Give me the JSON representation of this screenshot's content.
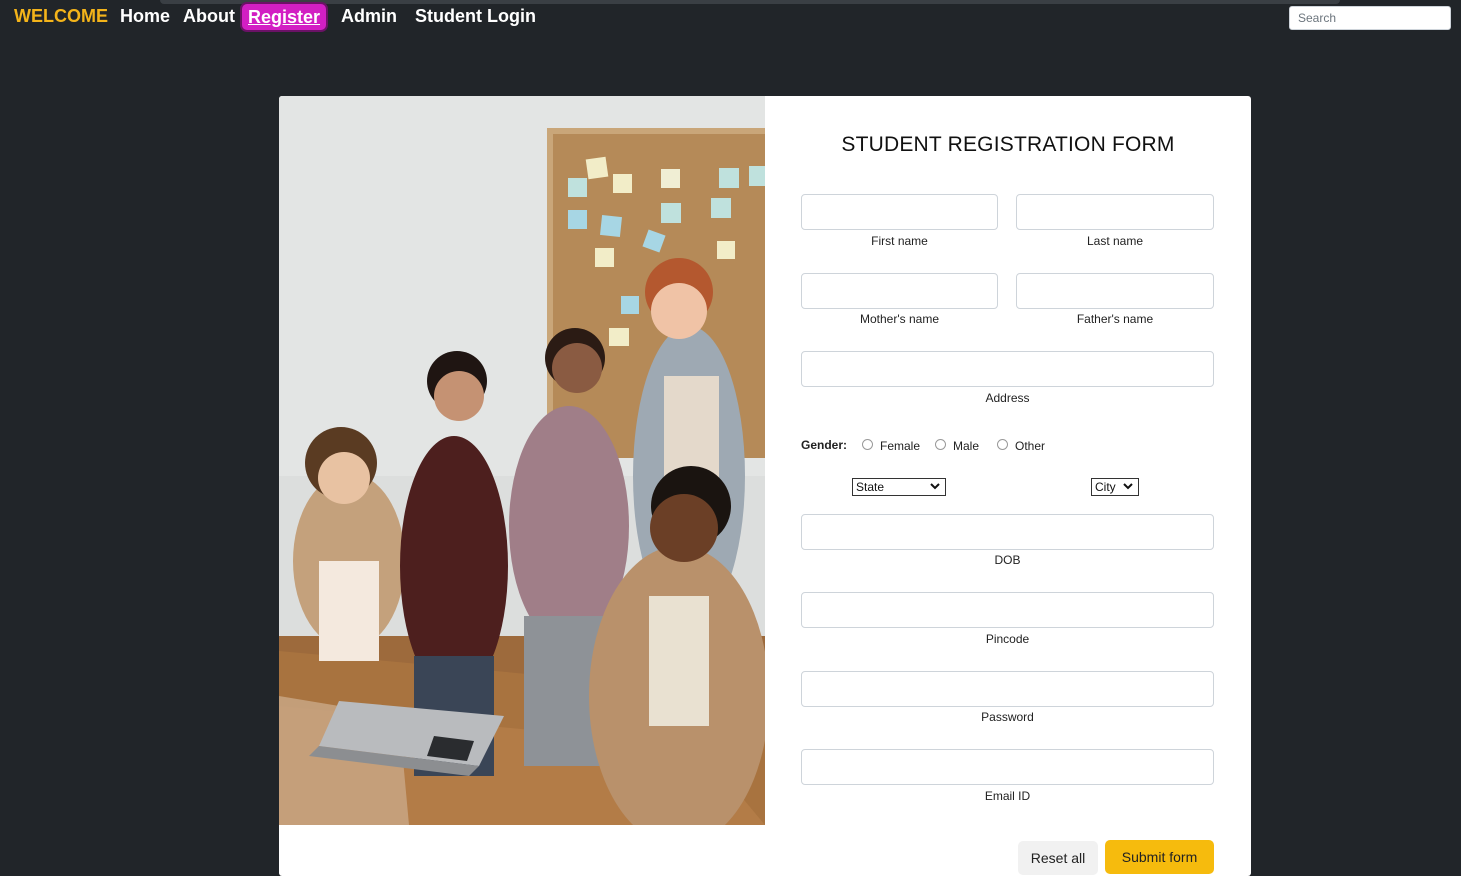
{
  "nav": {
    "brand": "WELCOME",
    "links": [
      "Home",
      "About",
      "Register",
      "Admin",
      "Student Login"
    ],
    "search_placeholder": "Search"
  },
  "form": {
    "title": "STUDENT REGISTRATION FORM",
    "first_name": "First name",
    "last_name": "Last name",
    "mother_name": "Mother's name",
    "father_name": "Father's name",
    "address": "Address",
    "gender_label": "Gender:",
    "gender_options": [
      "Female",
      "Male",
      "Other"
    ],
    "state": "State",
    "city": "City",
    "dob": "DOB",
    "pincode": "Pincode",
    "password": "Password",
    "email": "Email ID",
    "reset": "Reset all",
    "submit": "Submit form"
  },
  "colors": {
    "page_bg": "#212529",
    "brand": "#f4b41a",
    "active_link": "#d21fc3",
    "submit": "#f6bb0d"
  }
}
